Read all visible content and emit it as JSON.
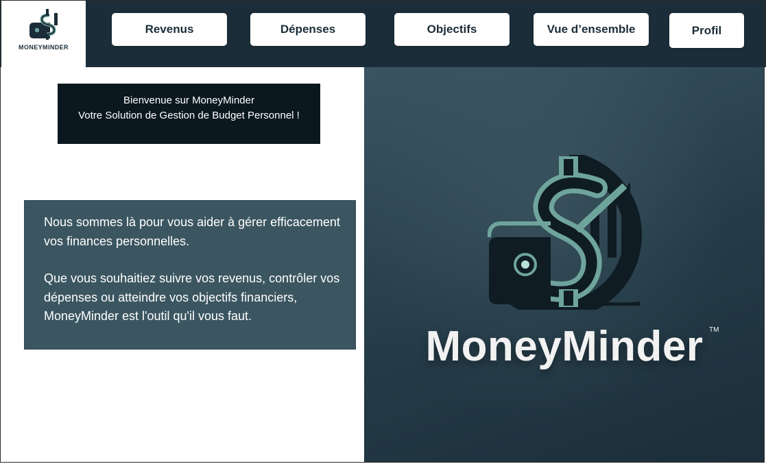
{
  "brand": {
    "logo_text": "MONEYMINDER",
    "hero_title": "MoneyMinder",
    "hero_tm": "TM"
  },
  "nav": {
    "items": [
      {
        "label": "Revenus"
      },
      {
        "label": "Dépenses"
      },
      {
        "label": "Objectifs"
      },
      {
        "label": "Vue d’ensemble"
      },
      {
        "label": "Profil"
      }
    ]
  },
  "welcome": {
    "line1": "Bienvenue sur MoneyMinder",
    "line2": "Votre Solution de Gestion de Budget Personnel !"
  },
  "info": {
    "paragraph1": "Nous sommes là  pour vous aider à gérer efficacement vos finances personnelles.",
    "paragraph2": "Que vous souhaitiez suivre vos revenus, contrôler vos dépenses ou atteindre vos objectifs financiers, MoneyMinder est l'outil qu'il vous faut."
  },
  "colors": {
    "navbar_bg": "#1b2d38",
    "welcome_bg": "#0b1820",
    "info_bg": "#3b5661",
    "accent_teal": "#6fa49d"
  }
}
